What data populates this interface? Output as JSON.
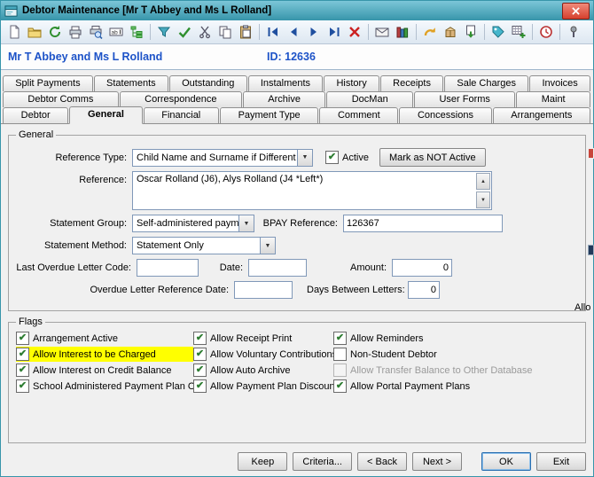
{
  "colors": {
    "titlebar": "#3795aa",
    "titlebar_light": "#7cc6d8",
    "accent": "#1d53c8",
    "highlight": "#ffff00",
    "close_red": "#d6402e"
  },
  "icons": {
    "check": "✔",
    "dropdown": "▼",
    "spinner_up": "▲",
    "spinner_down": "▼"
  },
  "window": {
    "title": "Debtor Maintenance  [Mr T Abbey and Ms L Rolland]"
  },
  "toolbar": {
    "icons": [
      {
        "name": "new-document"
      },
      {
        "name": "open-folder"
      },
      {
        "name": "refresh"
      },
      {
        "name": "print"
      },
      {
        "name": "print-preview"
      },
      {
        "name": "field-abl"
      },
      {
        "name": "tree-view"
      },
      {
        "name": "funnel-filter"
      },
      {
        "name": "confirm-check"
      },
      {
        "name": "cut"
      },
      {
        "name": "copy"
      },
      {
        "name": "paste"
      },
      {
        "name": "first-record"
      },
      {
        "name": "prev-record"
      },
      {
        "name": "next-record"
      },
      {
        "name": "last-record"
      },
      {
        "name": "delete-record"
      },
      {
        "name": "envelope"
      },
      {
        "name": "books"
      },
      {
        "name": "undo-arrow"
      },
      {
        "name": "package-box"
      },
      {
        "name": "export-download"
      },
      {
        "name": "tag-label"
      },
      {
        "name": "grid-add"
      },
      {
        "name": "history-clock"
      },
      {
        "name": "pin"
      }
    ]
  },
  "header": {
    "name": "Mr T Abbey and Ms L Rolland",
    "id": "ID: 12636"
  },
  "tabs": {
    "active": "General",
    "rows": [
      [
        "Split Payments",
        "Statements",
        "Outstanding",
        "Instalments",
        "History",
        "Receipts",
        "Sale Charges",
        "Invoices"
      ],
      [
        "Debtor Comms",
        "Correspondence",
        "Archive",
        "DocMan",
        "User Forms",
        "Maint"
      ],
      [
        "Debtor",
        "General",
        "Financial",
        "Payment Type",
        "Comment",
        "Concessions",
        "Arrangements"
      ]
    ]
  },
  "general": {
    "label": "General",
    "reference_type_label": "Reference Type:",
    "reference_type_value": "Child Name and Surname if Different",
    "active_label": "Active",
    "active_checked": true,
    "mark_not_active_label": "Mark as NOT Active",
    "reference_label": "Reference:",
    "reference_value": "Oscar Rolland (J6), Alys Rolland (J4 *Left*)",
    "statement_group_label": "Statement Group:",
    "statement_group_value": "Self-administered payment",
    "bpay_label": "BPAY Reference:",
    "bpay_value": "126367",
    "statement_method_label": "Statement Method:",
    "statement_method_value": "Statement Only",
    "last_overdue_label": "Last Overdue Letter Code:",
    "last_overdue_value": "",
    "date_label": "Date:",
    "date_value": "",
    "amount_label": "Amount:",
    "amount_value": "0",
    "overdue_ref_label": "Overdue Letter Reference Date:",
    "overdue_ref_value": "",
    "days_between_label": "Days Between Letters:",
    "days_between_value": "0"
  },
  "flags": {
    "label": "Flags",
    "cutoff": "Allo",
    "columns": [
      [
        {
          "label": "Arrangement Active",
          "checked": true
        },
        {
          "label": "Allow Interest to be Charged",
          "checked": true,
          "highlight": true
        },
        {
          "label": "Allow Interest on Credit Balance",
          "checked": true
        },
        {
          "label": "School Administered Payment Plan Only",
          "checked": true
        }
      ],
      [
        {
          "label": "Allow Receipt Print",
          "checked": true
        },
        {
          "label": "Allow Voluntary Contributions",
          "checked": true
        },
        {
          "label": "Allow Auto Archive",
          "checked": true
        },
        {
          "label": "Allow Payment Plan Discount",
          "checked": true
        }
      ],
      [
        {
          "label": "Allow Reminders",
          "checked": true
        },
        {
          "label": "Non-Student Debtor",
          "checked": false
        },
        {
          "label": "Allow Transfer Balance to Other Database",
          "checked": false,
          "disabled": true
        },
        {
          "label": "Allow Portal Payment Plans",
          "checked": true
        }
      ]
    ]
  },
  "footer": {
    "buttons": [
      {
        "label": "Keep"
      },
      {
        "label": "Criteria..."
      },
      {
        "label": "< Back"
      },
      {
        "label": "Next >"
      },
      {
        "label": "OK",
        "focused": true,
        "gap_before": true
      },
      {
        "label": "Exit"
      }
    ]
  }
}
